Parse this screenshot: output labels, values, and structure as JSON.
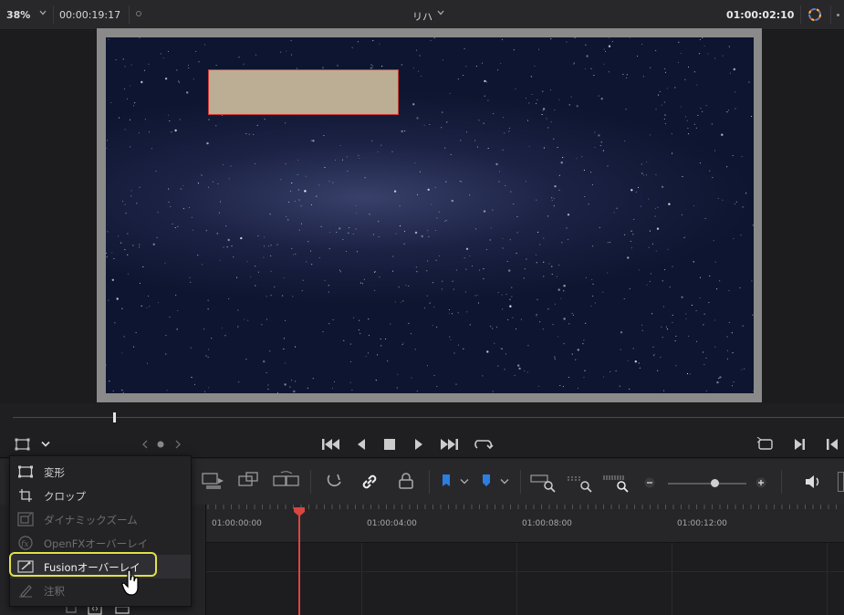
{
  "topbar": {
    "zoom": "38%",
    "source_timecode": "00:00:19:17",
    "clip_name": "リハ",
    "record_timecode": "01:00:02:10"
  },
  "viewer": {
    "image": "milky-way-starfield"
  },
  "transport": {
    "buttons": [
      "jump-to-start",
      "step-back",
      "stop",
      "play",
      "jump-to-end",
      "loop"
    ]
  },
  "timeline": {
    "ruler_labels": [
      "01:00:00:00",
      "01:00:04:00",
      "01:00:08:00",
      "01:00:12:00"
    ],
    "clip_color": "#bbae94",
    "playhead_color": "#d9463f"
  },
  "overlay_menu": {
    "items": [
      {
        "label": "変形",
        "icon": "transform-icon",
        "enabled": true
      },
      {
        "label": "クロップ",
        "icon": "crop-icon",
        "enabled": true
      },
      {
        "label": "ダイナミックズーム",
        "icon": "dynamic-zoom-icon",
        "enabled": false
      },
      {
        "label": "OpenFXオーバーレイ",
        "icon": "fx-icon",
        "enabled": false
      },
      {
        "label": "Fusionオーバーレイ",
        "icon": "fusion-icon",
        "enabled": true,
        "highlighted": true
      },
      {
        "label": "注釈",
        "icon": "annotation-pen-icon",
        "enabled": false
      }
    ],
    "highlight_color": "#e2e04a"
  },
  "toolbar": {
    "zoom_slider_level": 0.6
  }
}
